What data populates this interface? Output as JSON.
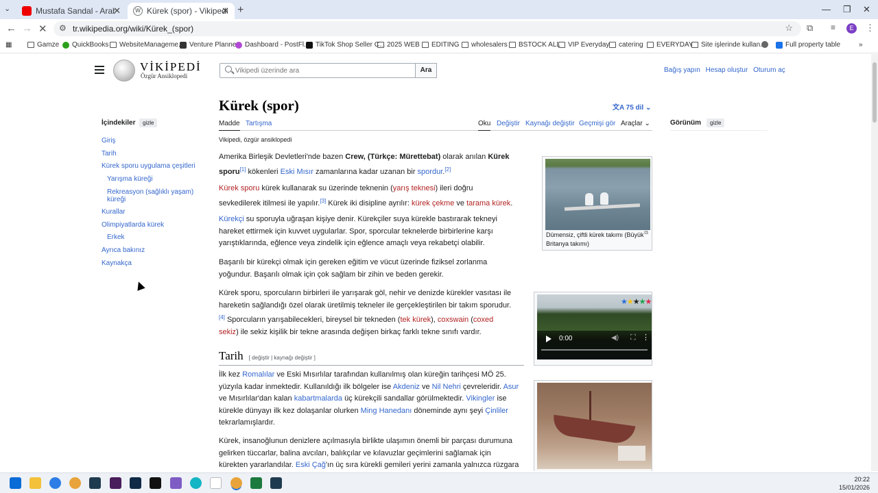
{
  "browser": {
    "tabs": [
      {
        "title": "Mustafa Sandal - Araba - YouTube",
        "favicon": "youtube-icon",
        "active": false
      },
      {
        "title": "Kürek (spor) - Vikipedi",
        "favicon": "wikipedia-icon",
        "active": true
      }
    ],
    "url": "tr.wikipedia.org/wiki/Kürek_(spor)",
    "bookmarks": [
      "Gamze",
      "QuickBooks",
      "WebsiteManageme...",
      "Venture Planner",
      "Dashboard - PostFl...",
      "TikTok Shop Seller C...",
      "2025 WEB",
      "EDITING",
      "wholesalers",
      "BSTOCK ALL",
      "VIP Everyday",
      "catering",
      "EVERYDAY",
      "Site işlerinde kullan...",
      "Full property table"
    ],
    "profile_initial": "E"
  },
  "site": {
    "name": "VİKİPEDİ",
    "tagline": "Özgür Ansiklopedi",
    "search_placeholder": "Vikipedi üzerinde ara",
    "search_button": "Ara",
    "user_links": [
      "Bağış yapın",
      "Hesap oluştur",
      "Oturum aç"
    ]
  },
  "toc": {
    "title": "İçindekiler",
    "hide_label": "gizle",
    "items": [
      {
        "label": "Giriş",
        "level": 1
      },
      {
        "label": "Tarih",
        "level": 1
      },
      {
        "label": "Kürek sporu uygulama çeşitleri",
        "level": 1
      },
      {
        "label": "Yarışma küreği",
        "level": 2
      },
      {
        "label": "Rekreasyon (sağlıklı yaşam) küreği",
        "level": 2
      },
      {
        "label": "Kurallar",
        "level": 1
      },
      {
        "label": "Olimpiyatlarda kürek",
        "level": 1
      },
      {
        "label": "Erkek",
        "level": 2
      },
      {
        "label": "Ayrıca bakınız",
        "level": 1
      },
      {
        "label": "Kaynakça",
        "level": 1
      }
    ]
  },
  "article": {
    "title": "Kürek (spor)",
    "languages": "75 dil",
    "tabs_left": [
      "Madde",
      "Tartışma"
    ],
    "tabs_right": [
      "Oku",
      "Değiştir",
      "Kaynağı değiştir",
      "Geçmişi gör",
      "Araçlar"
    ],
    "tagline": "Vikipedi, özgür ansiklopedi",
    "section_tarih": "Tarih",
    "section_edit": "[ değiştir | kaynağı değiştir ]"
  },
  "appearance": {
    "title": "Görünüm",
    "hide_label": "gizle"
  },
  "figures": {
    "fig1_caption": "Dümensiz, çiftli kürek takımı (Büyük Britanya takımı)",
    "video_time": "0:00"
  },
  "taskbar": {
    "time": "20:22",
    "date": "15/01/2026"
  },
  "colors": {
    "link": "#3366cc",
    "redlink": "#b22222",
    "chrome_bg": "#dfe7f5"
  }
}
